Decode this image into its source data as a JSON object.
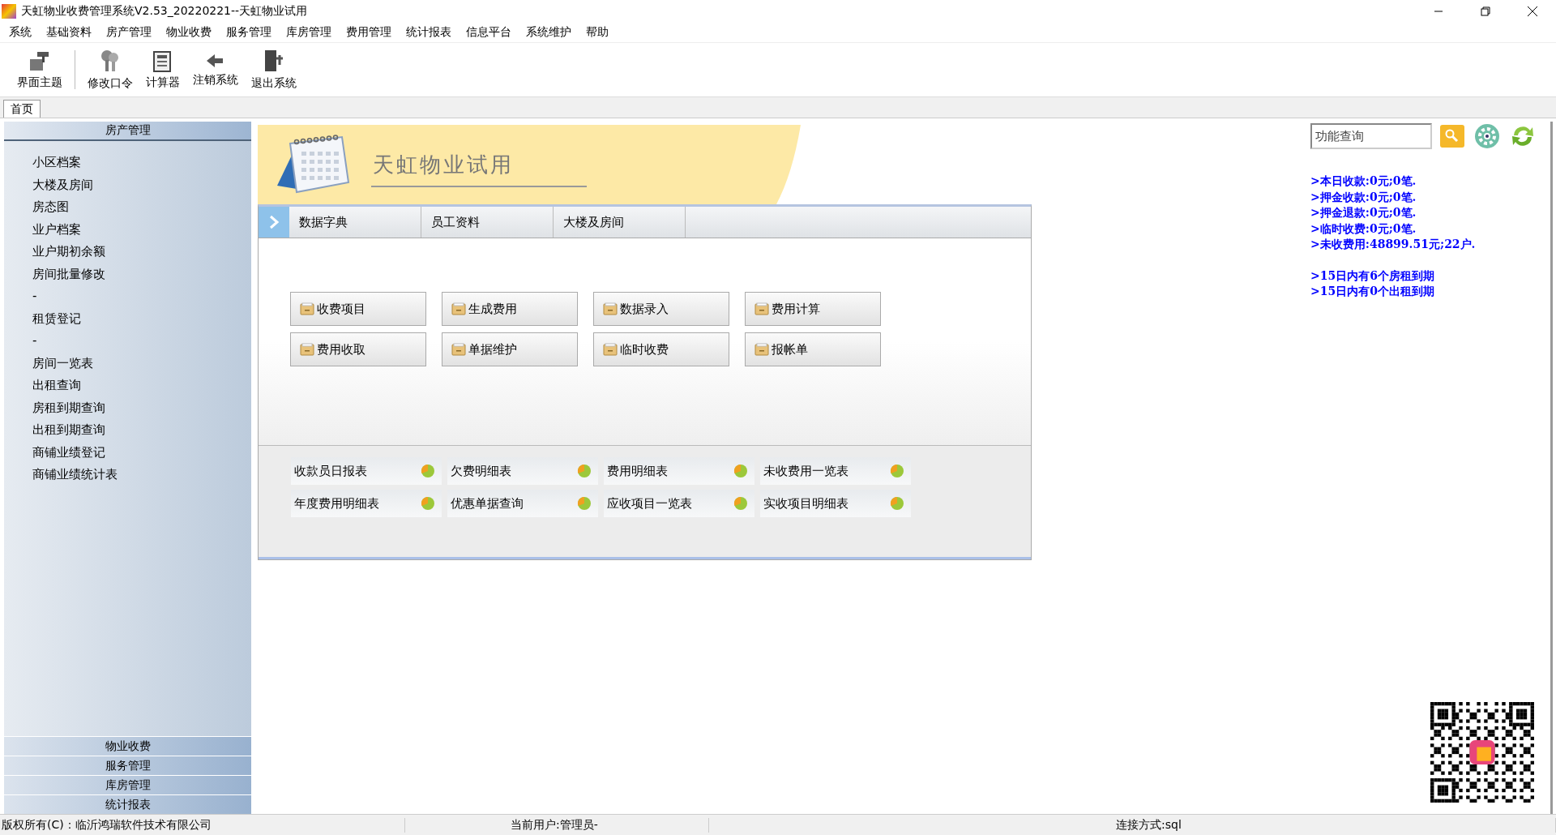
{
  "window": {
    "title": "天虹物业收费管理系统V2.53_20220221--天虹物业试用"
  },
  "menu": [
    "系统",
    "基础资料",
    "房产管理",
    "物业收费",
    "服务管理",
    "库房管理",
    "费用管理",
    "统计报表",
    "信息平台",
    "系统维护",
    "帮助"
  ],
  "toolbar": [
    {
      "label": "界面主题",
      "kind": "theme"
    },
    {
      "label": "修改口令",
      "kind": "keys"
    },
    {
      "label": "计算器",
      "kind": "calc"
    },
    {
      "label": "注销系统",
      "kind": "back"
    },
    {
      "label": "退出系统",
      "kind": "exit"
    }
  ],
  "tabs": [
    {
      "label": "首页",
      "selected": true
    }
  ],
  "sidebar": {
    "header": "房产管理",
    "items": [
      "小区档案",
      "大楼及房间",
      "房态图",
      "业户档案",
      "业户期初余额",
      "房间批量修改",
      "-",
      "租赁登记",
      "-",
      "房间一览表",
      "出租查询",
      "房租到期查询",
      "出租到期查询",
      "商铺业绩登记",
      "商铺业绩统计表"
    ],
    "sections": [
      "物业收费",
      "服务管理",
      "库房管理",
      "统计报表"
    ]
  },
  "banner": {
    "title": "天虹物业试用"
  },
  "subnav": [
    "数据字典",
    "员工资料",
    "大楼及房间"
  ],
  "function_buttons": [
    "收费项目",
    "生成费用",
    "数据录入",
    "费用计算",
    "费用收取",
    "单据维护",
    "临时收费",
    "报帐单"
  ],
  "reports": [
    "收款员日报表",
    "欠费明细表",
    "费用明细表",
    "未收费用一览表",
    "年度费用明细表",
    "优惠单据查询",
    "应收项目一览表",
    "实收项目明细表"
  ],
  "search": {
    "placeholder": "功能查询"
  },
  "info_lines": [
    ">本日收款:0元;0笔.",
    ">押金收款:0元;0笔.",
    ">押金退款:0元;0笔.",
    ">临时收费:0元;0笔.",
    ">未收费用:48899.51元;22户."
  ],
  "alerts": [
    ">15日内有6个房租到期",
    ">15日内有0个出租到期"
  ],
  "status_bar": [
    "版权所有(C)：临沂鸿瑞软件技术有限公司",
    "当前用户:管理员-",
    "连接方式:sql"
  ]
}
